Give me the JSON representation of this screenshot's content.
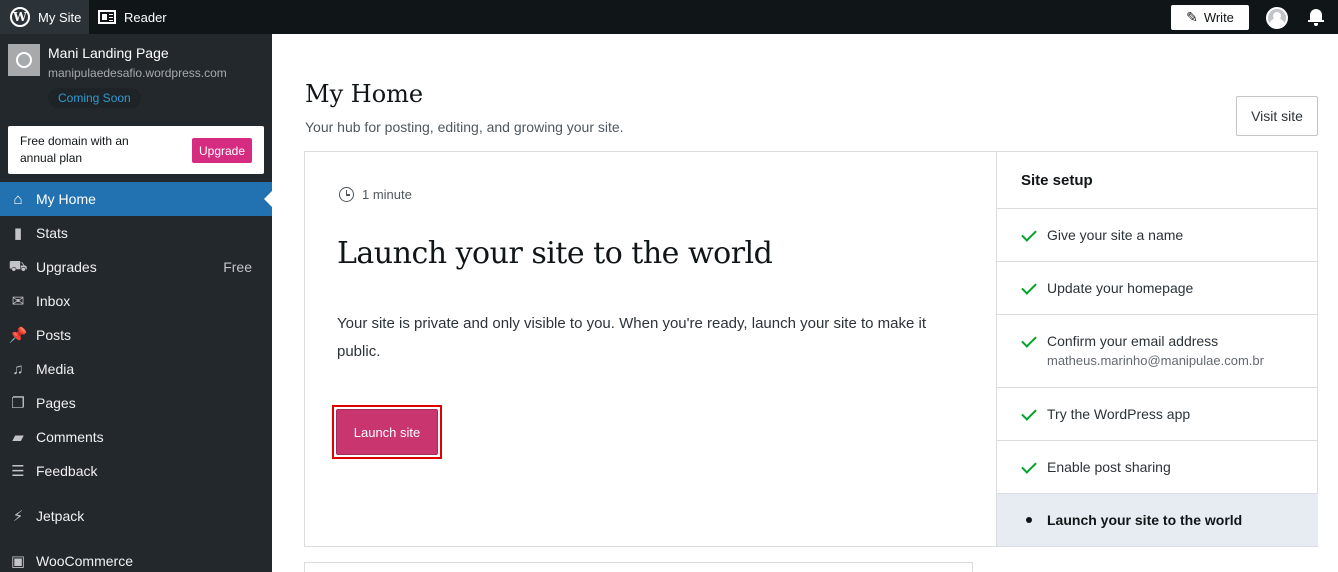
{
  "topbar": {
    "my_site": "My Site",
    "reader": "Reader",
    "write": "Write"
  },
  "site": {
    "name": "Mani Landing Page",
    "url": "manipulaedesafio.wordpress.com",
    "status": "Coming Soon"
  },
  "upsell": {
    "text": "Free domain with an annual plan",
    "button": "Upgrade"
  },
  "sidebar": {
    "items": [
      {
        "label": "My Home",
        "icon": "home-icon",
        "active": true
      },
      {
        "label": "Stats",
        "icon": "stats-icon"
      },
      {
        "label": "Upgrades",
        "icon": "cart-icon",
        "badge": "Free"
      },
      {
        "label": "Inbox",
        "icon": "mail-icon"
      },
      {
        "label": "Posts",
        "icon": "pin-icon"
      },
      {
        "label": "Media",
        "icon": "media-icon"
      },
      {
        "label": "Pages",
        "icon": "pages-icon"
      },
      {
        "label": "Comments",
        "icon": "comment-icon"
      },
      {
        "label": "Feedback",
        "icon": "feedback-icon"
      },
      {
        "label": "Jetpack",
        "icon": "jetpack-icon"
      },
      {
        "label": "WooCommerce",
        "icon": "woo-icon"
      }
    ]
  },
  "main": {
    "title": "My Home",
    "subtitle": "Your hub for posting, editing, and growing your site.",
    "visit_site": "Visit site"
  },
  "task": {
    "time": "1 minute",
    "title": "Launch your site to the world",
    "description": "Your site is private and only visible to you. When you're ready, launch your site to make it public.",
    "button": "Launch site"
  },
  "setup": {
    "title": "Site setup",
    "items": [
      {
        "label": "Give your site a name",
        "done": true
      },
      {
        "label": "Update your homepage",
        "done": true
      },
      {
        "label": "Confirm your email address",
        "sub": "matheus.marinho@manipulae.com.br",
        "done": true
      },
      {
        "label": "Try the WordPress app",
        "done": true
      },
      {
        "label": "Enable post sharing",
        "done": true
      },
      {
        "label": "Launch your site to the world",
        "done": false,
        "current": true
      }
    ]
  },
  "colors": {
    "accent": "#2271b1",
    "primary_button": "#c9356e",
    "upgrade": "#d52c82",
    "check": "#00a32a",
    "highlight_outline": "#e00000"
  }
}
